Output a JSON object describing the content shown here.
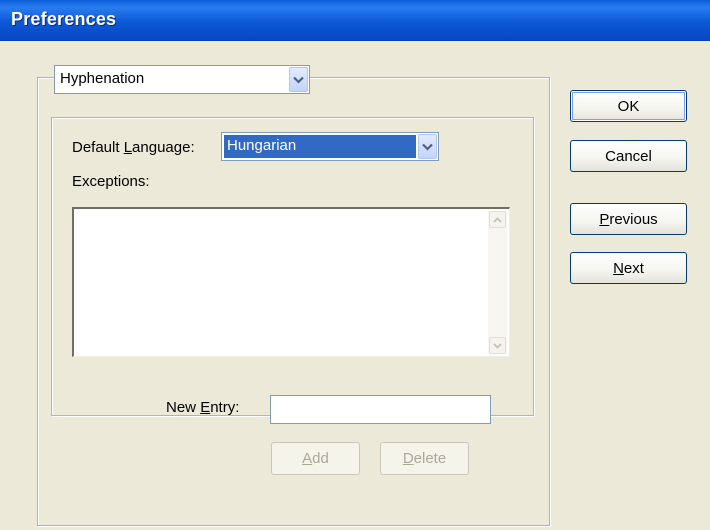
{
  "window": {
    "title": "Preferences"
  },
  "section_select": {
    "value": "Hyphenation"
  },
  "hyphenation": {
    "default_language_label_pre": "Default ",
    "default_language_label_accel": "L",
    "default_language_label_post": "anguage:",
    "default_language_value": "Hungarian",
    "exceptions_label": "Exceptions:",
    "exceptions_items": [],
    "new_entry_label_pre": "New ",
    "new_entry_label_accel": "E",
    "new_entry_label_post": "ntry:",
    "new_entry_value": "",
    "add_accel": "A",
    "add_rest": "dd",
    "delete_accel": "D",
    "delete_rest": "elete"
  },
  "buttons": {
    "ok_label": "OK",
    "cancel_label": "Cancel",
    "previous_accel": "P",
    "previous_rest": "revious",
    "next_accel": "N",
    "next_rest": "ext"
  },
  "colors": {
    "titlebar": "#0d58d6",
    "dialog_bg": "#ece9d8",
    "selection": "#316ac5"
  },
  "icons": {
    "dropdown": "chevron-down-icon",
    "scroll_up": "scroll-up-arrow-icon",
    "scroll_down": "scroll-down-arrow-icon"
  }
}
